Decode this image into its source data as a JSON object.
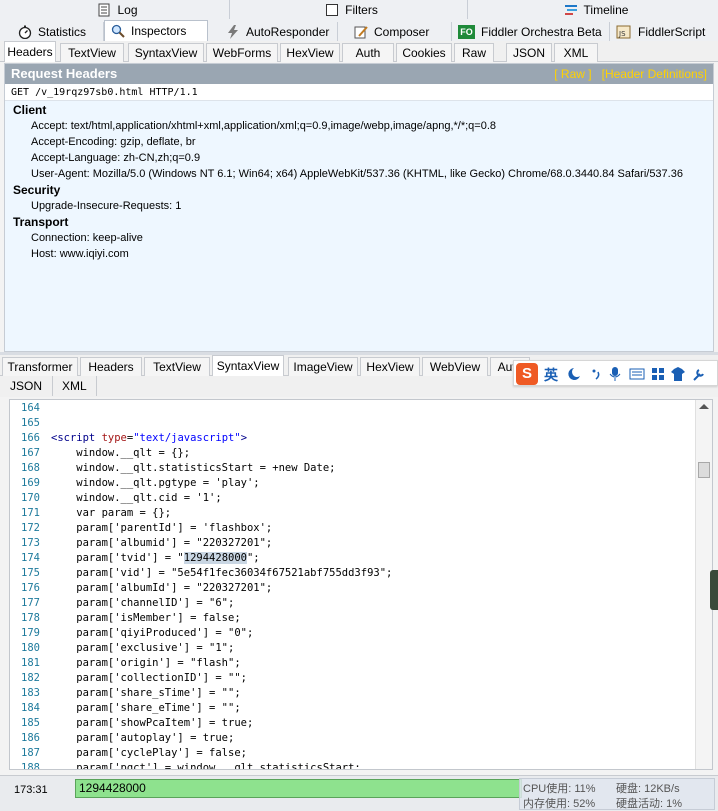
{
  "top_tabs_row1": [
    {
      "label": "Log",
      "icon": "log-icon"
    },
    {
      "label": "Filters",
      "icon": "checkbox-icon"
    },
    {
      "label": "Timeline",
      "icon": "timeline-icon"
    }
  ],
  "top_tabs_row2": [
    {
      "label": "Statistics",
      "icon": "stopwatch-icon"
    },
    {
      "label": "Inspectors",
      "icon": "magnifier-icon"
    },
    {
      "label": "AutoResponder",
      "icon": "lightning-icon"
    },
    {
      "label": "Composer",
      "icon": "pencil-icon"
    },
    {
      "label": "Fiddler Orchestra Beta",
      "icon": "fo-badge-icon",
      "badge": "FO"
    },
    {
      "label": "FiddlerScript",
      "icon": "script-icon",
      "badge": "JS"
    }
  ],
  "request_tabs": [
    "Headers",
    "TextView",
    "SyntaxView",
    "WebForms",
    "HexView",
    "Auth",
    "Cookies",
    "Raw",
    "JSON",
    "XML"
  ],
  "request_headers": {
    "title": "Request Headers",
    "raw_link": "[ Raw ]",
    "defs_link": "[Header Definitions]",
    "request_line": "GET /v_19rqz97sb0.html HTTP/1.1",
    "groups": [
      {
        "name": "Client",
        "headers": [
          "Accept: text/html,application/xhtml+xml,application/xml;q=0.9,image/webp,image/apng,*/*;q=0.8",
          "Accept-Encoding: gzip, deflate, br",
          "Accept-Language: zh-CN,zh;q=0.9",
          "User-Agent: Mozilla/5.0 (Windows NT 6.1; Win64; x64) AppleWebKit/537.36 (KHTML, like Gecko) Chrome/68.0.3440.84 Safari/537.36"
        ]
      },
      {
        "name": "Security",
        "headers": [
          "Upgrade-Insecure-Requests: 1"
        ]
      },
      {
        "name": "Transport",
        "headers": [
          "Connection: keep-alive",
          "Host: www.iqiyi.com"
        ]
      }
    ]
  },
  "response_tabs": [
    "Transformer",
    "Headers",
    "TextView",
    "SyntaxView",
    "ImageView",
    "HexView",
    "WebView",
    "Auth"
  ],
  "response_tabs_row2": [
    "JSON",
    "XML"
  ],
  "ime_toolbar": {
    "lang": "英",
    "brand": "S"
  },
  "code": {
    "lines": [
      {
        "n": "164",
        "t": ""
      },
      {
        "n": "165",
        "t": ""
      },
      {
        "n": "166",
        "t": "<script type=\"text/javascript\">"
      },
      {
        "n": "167",
        "t": "    window.__qlt = {};"
      },
      {
        "n": "168",
        "t": "    window.__qlt.statisticsStart = +new Date;"
      },
      {
        "n": "169",
        "t": "    window.__qlt.pgtype = 'play';"
      },
      {
        "n": "170",
        "t": "    window.__qlt.cid = '1';"
      },
      {
        "n": "171",
        "t": "    var param = {};"
      },
      {
        "n": "172",
        "t": "    param['parentId'] = 'flashbox';"
      },
      {
        "n": "173",
        "t": "    param['albumid'] = \"220327201\";"
      },
      {
        "n": "174",
        "t": "    param['tvid'] = \"1294428000\";"
      },
      {
        "n": "175",
        "t": "    param['vid'] = \"5e54f1fec36034f67521abf755dd3f93\";"
      },
      {
        "n": "176",
        "t": "    param['albumId'] = \"220327201\";"
      },
      {
        "n": "177",
        "t": "    param['channelID'] = \"6\";"
      },
      {
        "n": "178",
        "t": "    param['isMember'] = false;"
      },
      {
        "n": "179",
        "t": "    param['qiyiProduced'] = \"0\";"
      },
      {
        "n": "180",
        "t": "    param['exclusive'] = \"1\";"
      },
      {
        "n": "181",
        "t": "    param['origin'] = \"flash\";"
      },
      {
        "n": "182",
        "t": "    param['collectionID'] = \"\";"
      },
      {
        "n": "183",
        "t": "    param['share_sTime'] = \"\";"
      },
      {
        "n": "184",
        "t": "    param['share_eTime'] = \"\";"
      },
      {
        "n": "185",
        "t": "    param['showPcaItem'] = true;"
      },
      {
        "n": "186",
        "t": "    param['autoplay'] = true;"
      },
      {
        "n": "187",
        "t": "    param['cyclePlay'] = false;"
      },
      {
        "n": "188",
        "t": "    param['pgct'] = window.__qlt.statisticsStart;"
      }
    ],
    "highlight": "1294428000"
  },
  "status": {
    "position": "173:31",
    "quickexec_value": "1294428000",
    "cpu": "CPU使用: 11%",
    "disk": "硬盘: 12KB/s",
    "mem": "内存使用: 52%",
    "disk_activity": "硬盘活动: 1%"
  }
}
